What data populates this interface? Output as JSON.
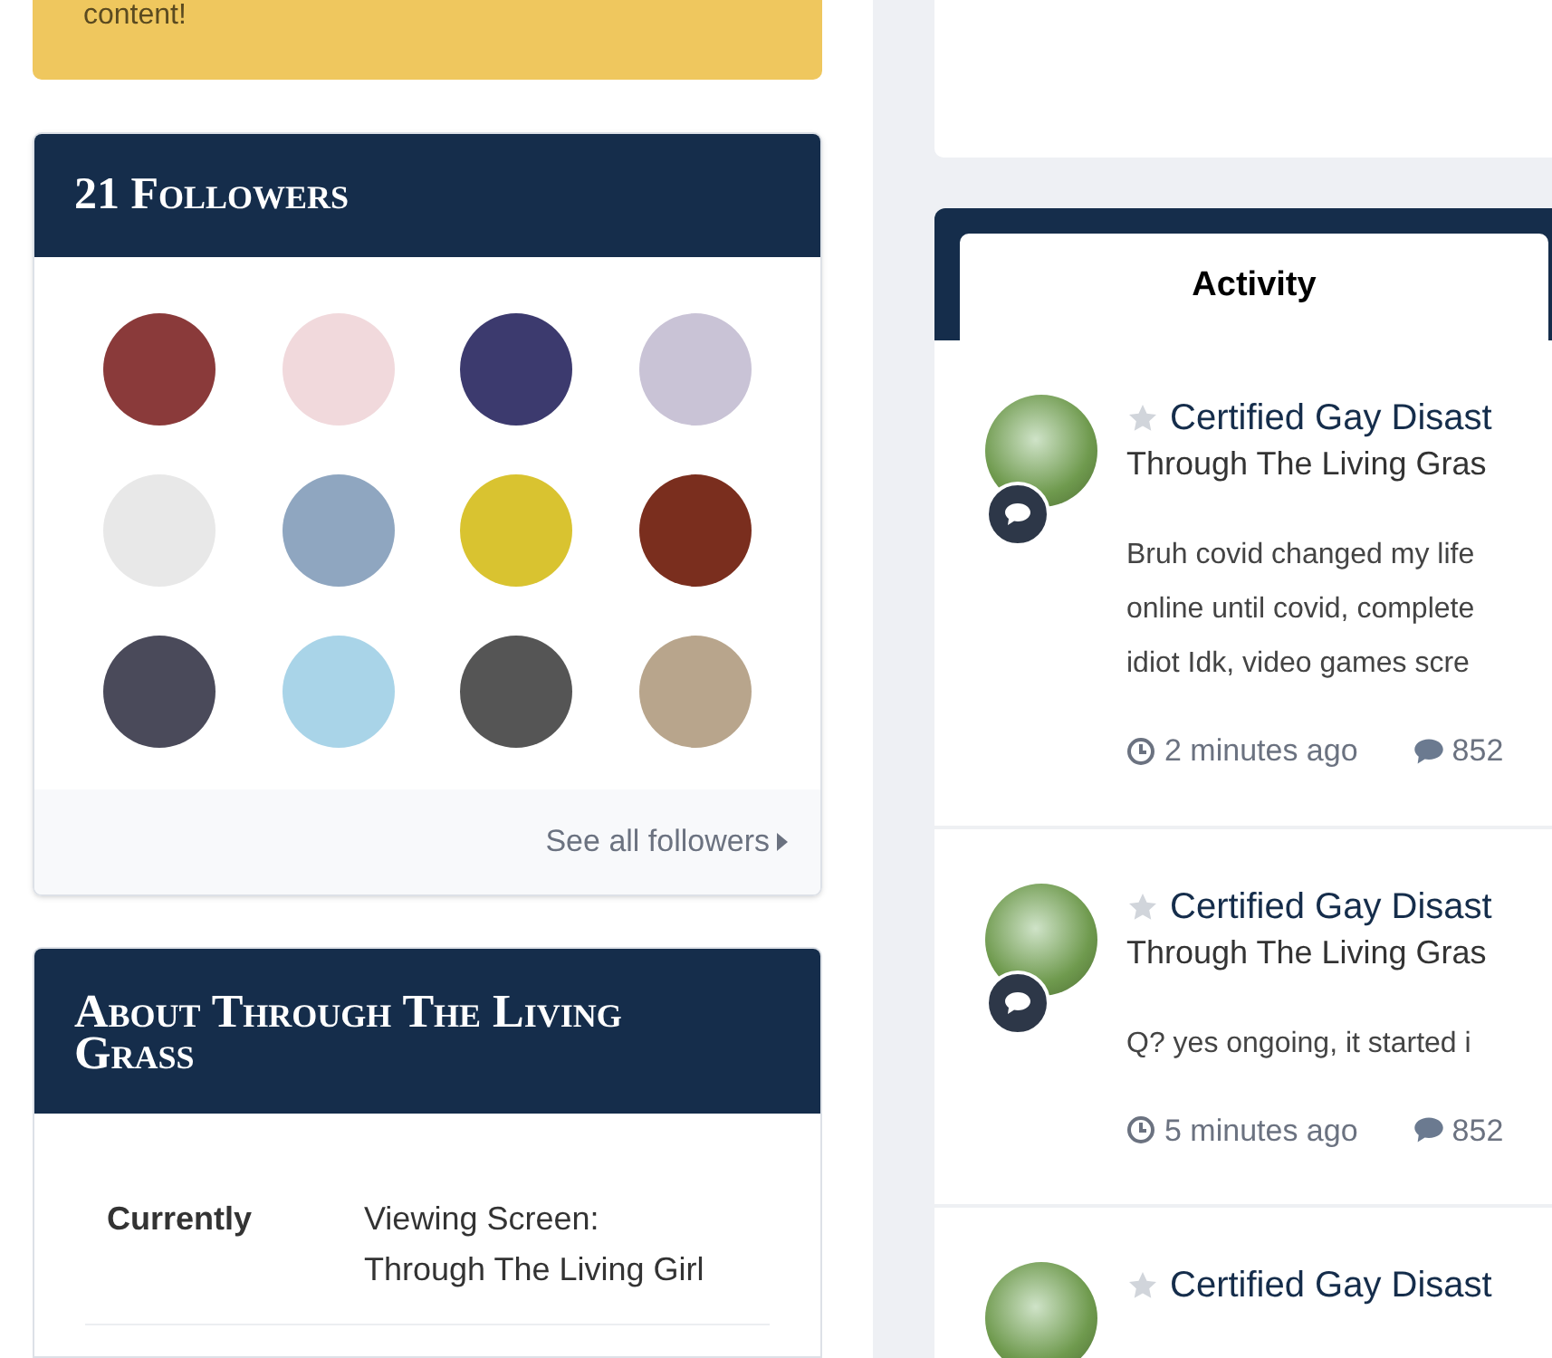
{
  "notice": {
    "text": "content!"
  },
  "followers": {
    "title": "21 Followers",
    "see_all": "See all followers"
  },
  "about": {
    "title": "About Through The Living Grass",
    "fields": [
      {
        "label": "Currently",
        "value_lines": [
          "Viewing Screen:",
          "Through The Living Girl"
        ]
      }
    ]
  },
  "activity": {
    "tabs": [
      {
        "label": "Activity",
        "selected": true
      }
    ],
    "items": [
      {
        "author": "Certified Gay Disast",
        "profile": "Through The Living Gras",
        "body_lines": [
          "Bruh covid changed my life",
          "online until covid, complete",
          "idiot Idk, video games scre"
        ],
        "time": "2 minutes ago",
        "comments": "852"
      },
      {
        "author": "Certified Gay Disast",
        "profile": "Through The Living Gras",
        "body_lines": [
          "Q? yes ongoing, it started i"
        ],
        "time": "5 minutes ago",
        "comments": "852"
      },
      {
        "author": "Certified Gay Disast"
      }
    ]
  }
}
